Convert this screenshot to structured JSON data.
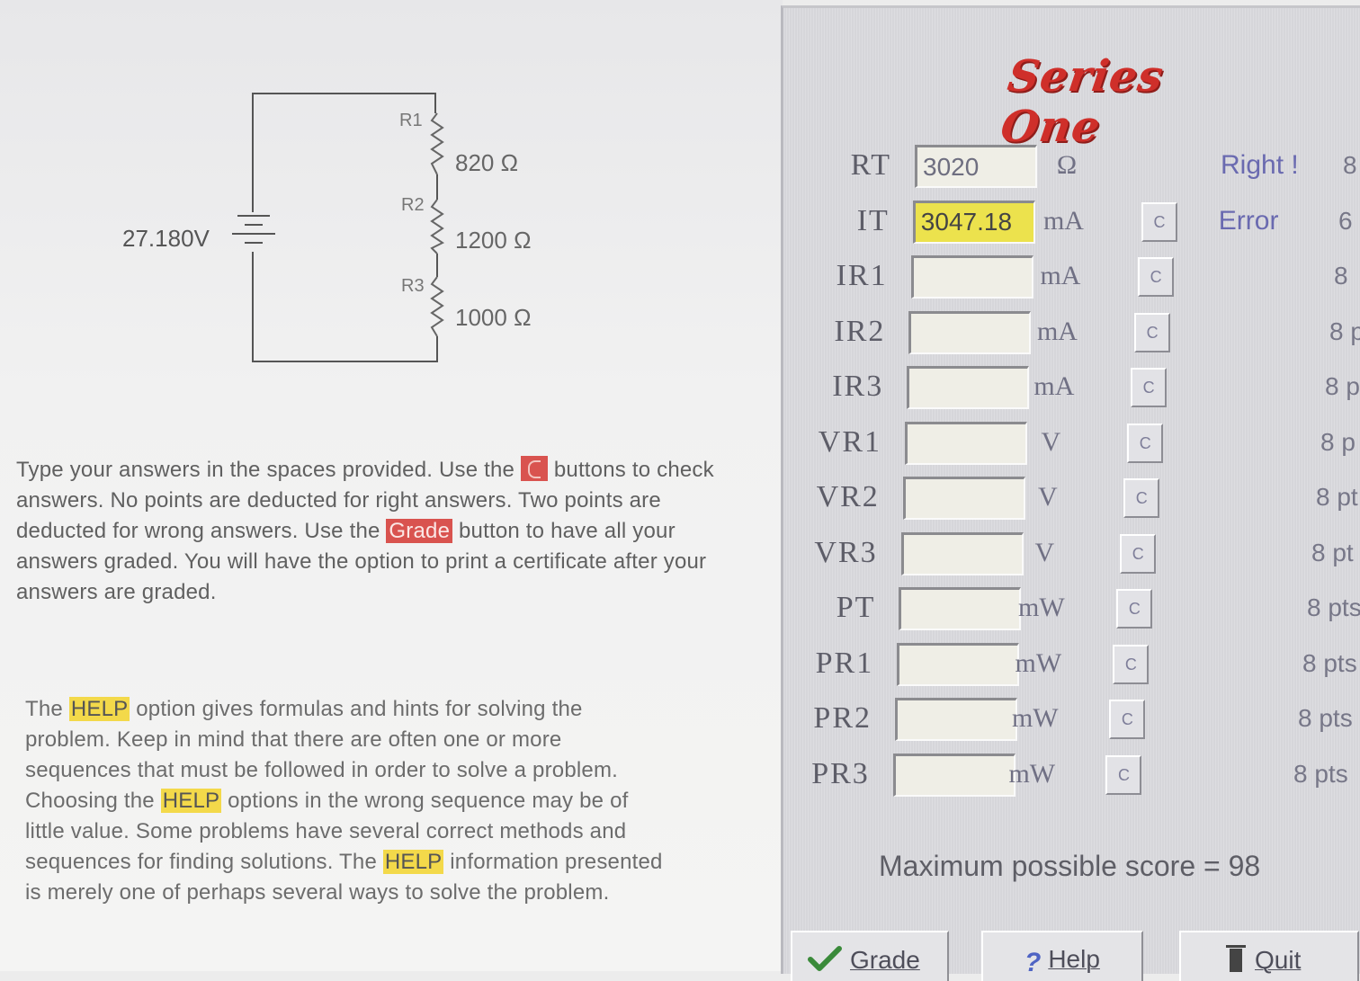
{
  "circuit": {
    "source_voltage": "27.180V",
    "resistors": [
      {
        "name": "R1",
        "value": "820 Ω"
      },
      {
        "name": "R2",
        "value": "1200 Ω"
      },
      {
        "name": "R3",
        "value": "1000 Ω"
      }
    ]
  },
  "instructions": {
    "p1_a": "Type your answers in the spaces provided.  Use the",
    "p1_b": "buttons to check answers. No points are deducted for right answers. Two points are deducted for wrong answers. Use the",
    "grade_word": "Grade",
    "p1_c": "button to have all your answers graded. You will have the option to print a certificate after your answers are graded.",
    "help_word": "HELP",
    "p2_a": "The",
    "p2_b": "option gives formulas and hints for solving the problem. Keep in mind that there are often one or more sequences that must be followed in order to solve a problem. Choosing the",
    "p2_c": "options in the wrong sequence may be of little value. Some problems have several correct methods and sequences for finding solutions. The",
    "p2_d": "information presented is merely one of perhaps several ways to solve the problem."
  },
  "title": "Series One",
  "rows": [
    {
      "label": "RT",
      "value": "3020",
      "unit": "Ω",
      "has_check": false,
      "status": "Right !",
      "points": "8"
    },
    {
      "label": "IT",
      "value": "3047.18",
      "unit": "mA",
      "has_check": true,
      "status": "Error",
      "points": "6"
    },
    {
      "label": "IR1",
      "value": "",
      "unit": "mA",
      "has_check": true,
      "status": "",
      "points": "8"
    },
    {
      "label": "IR2",
      "value": "",
      "unit": "mA",
      "has_check": true,
      "status": "",
      "points": "8 p"
    },
    {
      "label": "IR3",
      "value": "",
      "unit": "mA",
      "has_check": true,
      "status": "",
      "points": "8 p"
    },
    {
      "label": "VR1",
      "value": "",
      "unit": "V",
      "has_check": true,
      "status": "",
      "points": "8 p"
    },
    {
      "label": "VR2",
      "value": "",
      "unit": "V",
      "has_check": true,
      "status": "",
      "points": "8 pt"
    },
    {
      "label": "VR3",
      "value": "",
      "unit": "V",
      "has_check": true,
      "status": "",
      "points": "8 pt"
    },
    {
      "label": "PT",
      "value": "",
      "unit": "mW",
      "has_check": true,
      "status": "",
      "points": "8 pts"
    },
    {
      "label": "PR1",
      "value": "",
      "unit": "mW",
      "has_check": true,
      "status": "",
      "points": "8 pts"
    },
    {
      "label": "PR2",
      "value": "",
      "unit": "mW",
      "has_check": true,
      "status": "",
      "points": "8 pts"
    },
    {
      "label": "PR3",
      "value": "",
      "unit": "mW",
      "has_check": true,
      "status": "",
      "points": "8 pts"
    }
  ],
  "check_label": "C",
  "max_score": "Maximum possible score = 98",
  "buttons": {
    "grade": "Grade",
    "help": "Help",
    "quit": "Quit"
  },
  "icons": {
    "grade": "check-icon",
    "help": "question-icon",
    "quit": "door-icon"
  },
  "colors": {
    "title": "#cf2f2a",
    "highlight_field": "#ece24d",
    "grade_highlight": "#d9534f",
    "help_highlight": "#f3d94a"
  }
}
